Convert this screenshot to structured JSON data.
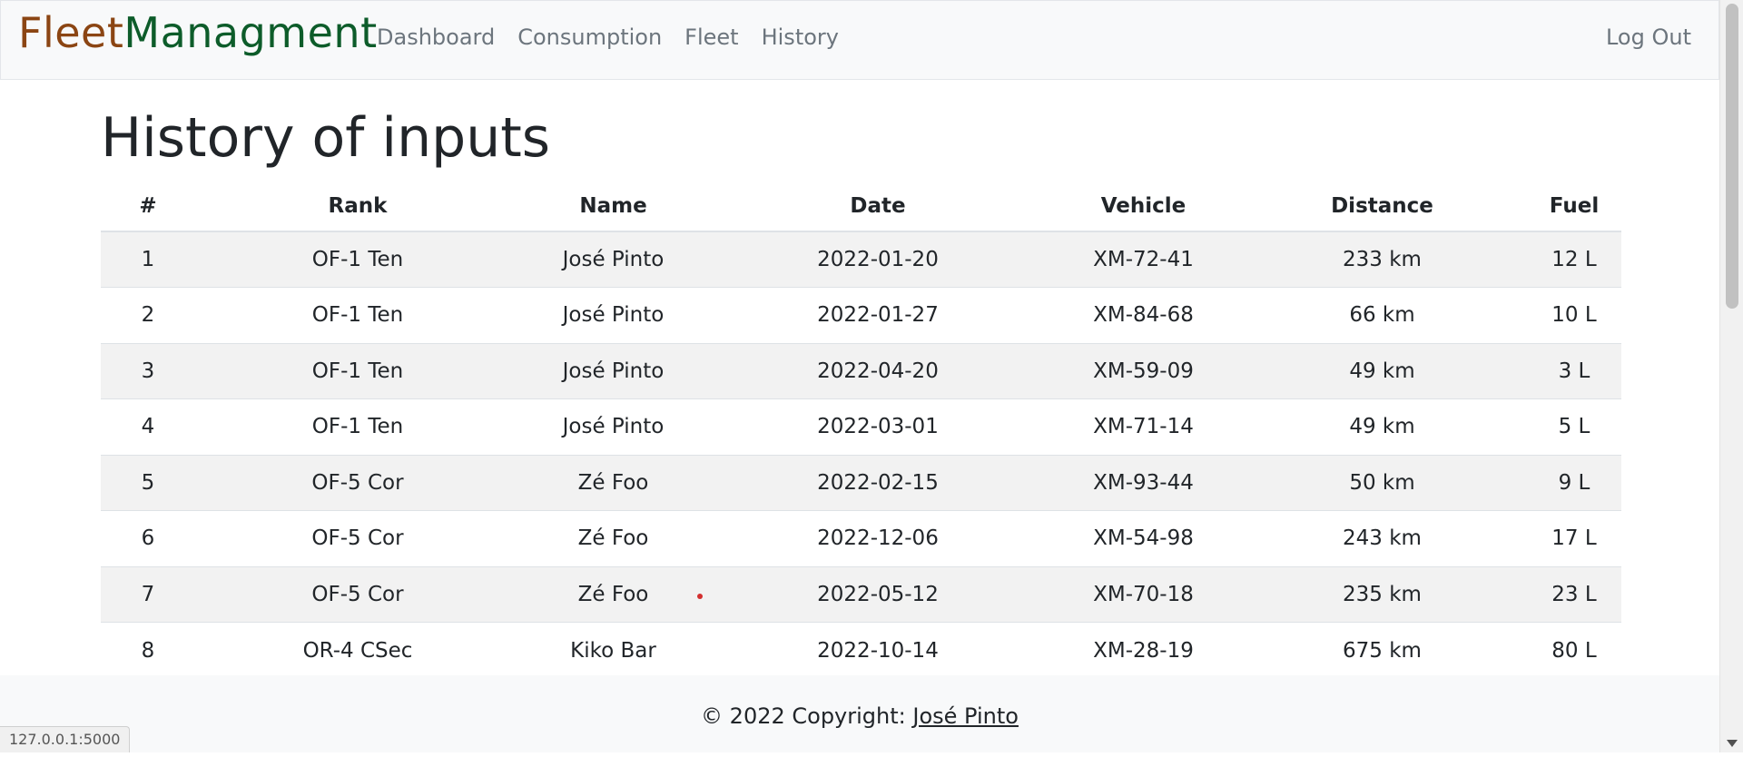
{
  "navbar": {
    "brand_part1": "Fleet",
    "brand_part2": "Managment",
    "links": [
      "Dashboard",
      "Consumption",
      "Fleet",
      "History"
    ],
    "logout": "Log Out"
  },
  "page": {
    "title": "History of inputs"
  },
  "table": {
    "headers": [
      "#",
      "Rank",
      "Name",
      "Date",
      "Vehicle",
      "Distance",
      "Fuel"
    ],
    "rows": [
      [
        "1",
        "OF-1 Ten",
        "José Pinto",
        "2022-01-20",
        "XM-72-41",
        "233 km",
        "12 L"
      ],
      [
        "2",
        "OF-1 Ten",
        "José Pinto",
        "2022-01-27",
        "XM-84-68",
        "66 km",
        "10 L"
      ],
      [
        "3",
        "OF-1 Ten",
        "José Pinto",
        "2022-04-20",
        "XM-59-09",
        "49 km",
        "3 L"
      ],
      [
        "4",
        "OF-1 Ten",
        "José Pinto",
        "2022-03-01",
        "XM-71-14",
        "49 km",
        "5 L"
      ],
      [
        "5",
        "OF-5 Cor",
        "Zé Foo",
        "2022-02-15",
        "XM-93-44",
        "50 km",
        "9 L"
      ],
      [
        "6",
        "OF-5 Cor",
        "Zé Foo",
        "2022-12-06",
        "XM-54-98",
        "243 km",
        "17 L"
      ],
      [
        "7",
        "OF-5 Cor",
        "Zé Foo",
        "2022-05-12",
        "XM-70-18",
        "235 km",
        "23 L"
      ],
      [
        "8",
        "OR-4 CSec",
        "Kiko Bar",
        "2022-10-14",
        "XM-28-19",
        "675 km",
        "80 L"
      ]
    ]
  },
  "footer": {
    "text": "© 2022 Copyright: ",
    "author": "José Pinto"
  },
  "status_bar": {
    "url": "127.0.0.1:5000"
  },
  "colors": {
    "brand_part1": "#8b4513",
    "brand_part2": "#0d5c2a",
    "navbar_bg": "#f8f9fa",
    "stripe": "#f2f2f2"
  }
}
